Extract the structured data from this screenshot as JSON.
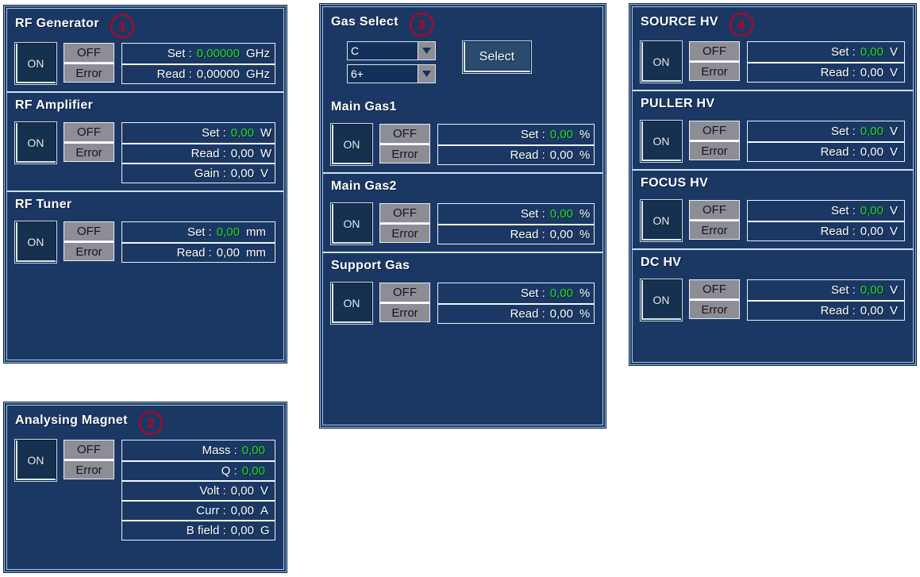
{
  "colors": {
    "panel_bg": "#1b3864",
    "panel_border": "#a8c4e0",
    "text": "#ffffff",
    "setpoint_green": "#22dd22",
    "callout_red": "#c2001e",
    "lamp_gray": "#8d8d96"
  },
  "common": {
    "on_label": "ON",
    "off_label": "OFF",
    "error_label": "Error"
  },
  "panels": {
    "left": {
      "sections": [
        {
          "title": "RF Generator",
          "badge": "1",
          "rows": [
            {
              "label": "Set :",
              "value": "0,00000",
              "unit": "GHz",
              "green": true
            },
            {
              "label": "Read :",
              "value": "0,00000",
              "unit": "GHz",
              "green": false
            }
          ]
        },
        {
          "title": "RF Amplifier",
          "badge": "",
          "rows": [
            {
              "label": "Set :",
              "value": "0,00",
              "unit": "W",
              "green": true
            },
            {
              "label": "Read :",
              "value": "0,00",
              "unit": "W",
              "green": false
            },
            {
              "label": "Gain :",
              "value": "0,00",
              "unit": "V",
              "green": false
            }
          ]
        },
        {
          "title": "RF Tuner",
          "badge": "",
          "rows": [
            {
              "label": "Set :",
              "value": "0,00",
              "unit": "mm",
              "green": true
            },
            {
              "label": "Read :",
              "value": "0,00",
              "unit": "mm",
              "green": false
            }
          ]
        }
      ]
    },
    "magnet": {
      "sections": [
        {
          "title": "Analysing Magnet",
          "badge": "2",
          "rows": [
            {
              "label": "Mass :",
              "value": "0,00",
              "unit": "",
              "green": true
            },
            {
              "label": "Q :",
              "value": "0,00",
              "unit": "",
              "green": true
            },
            {
              "label": "Volt :",
              "value": "0,00",
              "unit": "V",
              "green": false
            },
            {
              "label": "Curr :",
              "value": "0,00",
              "unit": "A",
              "green": false
            },
            {
              "label": "B field :",
              "value": "0,00",
              "unit": "G",
              "green": false
            }
          ]
        }
      ]
    },
    "middle": {
      "gas_select": {
        "title": "Gas Select",
        "badge": "3",
        "element_value": "C",
        "charge_value": "6+",
        "select_button": "Select"
      },
      "sections": [
        {
          "title": "Main Gas1",
          "badge": "",
          "rows": [
            {
              "label": "Set :",
              "value": "0,00",
              "unit": "%",
              "green": true
            },
            {
              "label": "Read :",
              "value": "0,00",
              "unit": "%",
              "green": false
            }
          ]
        },
        {
          "title": "Main Gas2",
          "badge": "",
          "rows": [
            {
              "label": "Set :",
              "value": "0,00",
              "unit": "%",
              "green": true
            },
            {
              "label": "Read :",
              "value": "0,00",
              "unit": "%",
              "green": false
            }
          ]
        },
        {
          "title": "Support Gas",
          "badge": "",
          "rows": [
            {
              "label": "Set :",
              "value": "0,00",
              "unit": "%",
              "green": true
            },
            {
              "label": "Read :",
              "value": "0,00",
              "unit": "%",
              "green": false
            }
          ]
        }
      ]
    },
    "right": {
      "sections": [
        {
          "title": "SOURCE HV",
          "badge": "4",
          "rows": [
            {
              "label": "Set :",
              "value": "0,00",
              "unit": "V",
              "green": true
            },
            {
              "label": "Read :",
              "value": "0,00",
              "unit": "V",
              "green": false
            }
          ]
        },
        {
          "title": "PULLER HV",
          "badge": "",
          "rows": [
            {
              "label": "Set :",
              "value": "0,00",
              "unit": "V",
              "green": true
            },
            {
              "label": "Read :",
              "value": "0,00",
              "unit": "V",
              "green": false
            }
          ]
        },
        {
          "title": "FOCUS HV",
          "badge": "",
          "rows": [
            {
              "label": "Set :",
              "value": "0,00",
              "unit": "V",
              "green": true
            },
            {
              "label": "Read :",
              "value": "0,00",
              "unit": "V",
              "green": false
            }
          ]
        },
        {
          "title": "DC HV",
          "badge": "",
          "rows": [
            {
              "label": "Set :",
              "value": "0,00",
              "unit": "V",
              "green": true
            },
            {
              "label": "Read :",
              "value": "0,00",
              "unit": "V",
              "green": false
            }
          ]
        }
      ]
    }
  }
}
